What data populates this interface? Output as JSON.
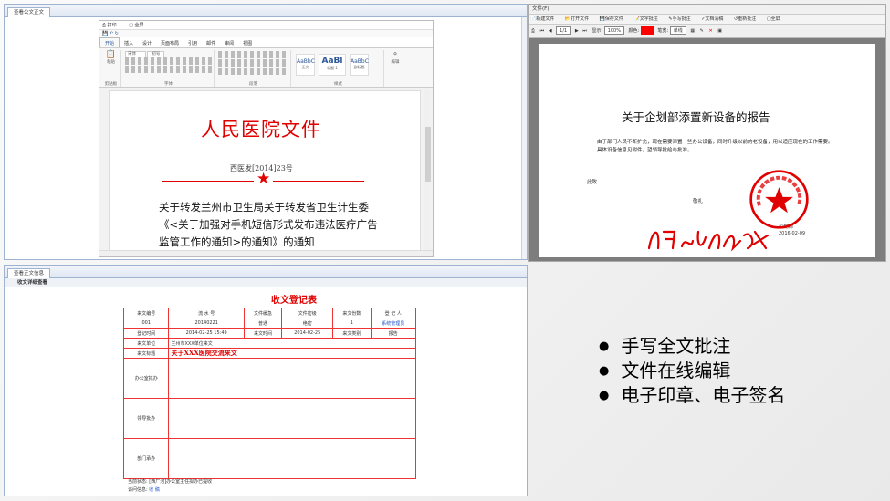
{
  "word_pane": {
    "tab": "查看公文正文",
    "toolbar": {
      "print": "打印",
      "fullscreen": "全屏"
    },
    "ribbon_tabs": [
      "开始",
      "插入",
      "设计",
      "页面布局",
      "引用",
      "邮件",
      "审阅",
      "视图"
    ],
    "ribbon_groups": {
      "clipboard": "剪贴板",
      "font": "字体",
      "paragraph": "段落",
      "styles": "样式",
      "editing": "编辑"
    },
    "paste": "粘贴",
    "font_name": "宋体",
    "font_size": "初号",
    "styles": [
      "AaBbC",
      "AaBl",
      "AaBbC"
    ],
    "style_names": [
      "正文",
      "标题 1",
      "副标题"
    ],
    "doc": {
      "red_title": "人民医院文件",
      "doc_number": "西医发[2014]23号",
      "title": "关于转发兰州市卫生局关于转发省卫生计生委《<关于加强对手机短信形式发布违法医疗广告监管工作的通知>的通知》的通知"
    }
  },
  "pdf_pane": {
    "menu": "文件(F)",
    "toolbar": [
      "新建文件",
      "打开文件",
      "保存文件",
      "文字批注",
      "手写批注",
      "文档清稿",
      "重新批注",
      "全屏"
    ],
    "nav": {
      "page": "1/1",
      "display_label": "显示:",
      "zoom": "100%",
      "color_label": "颜色:",
      "pen_label": "笔宽:",
      "pen_value": "单线",
      "accent_color": "#ff0000"
    },
    "doc": {
      "title": "关于企划部添置新设备的报告",
      "body1": "由于部门人员不断扩充，现在需要添置一些办公设备，同时升级以前的老设备，用以适应现在的工作需要。",
      "body2": "具体设备信息见附件，望领导批给与批准。",
      "greeting": "此致",
      "thanks": "敬礼",
      "dept": "企划部",
      "date": "2016-02-09",
      "seal_text": "四川省旅游信息中心",
      "signature": "同意。2017年10月13日"
    }
  },
  "form_pane": {
    "tab": "查看正文信息",
    "subtitle": "收文详细查看",
    "title": "收文登记表",
    "headers": [
      "来文编号",
      "流 水 号",
      "文件缓急",
      "文件密级",
      "来文份数",
      "登 记 人"
    ],
    "row1": [
      "001",
      "20140221",
      "普通",
      "绝密",
      "1",
      "系统管理员"
    ],
    "row2": {
      "label": "登记时间",
      "time": "2014-02-25 15:49",
      "recv_label": "来文时间",
      "recv": "2014-02-25",
      "type_label": "来文类别",
      "type": "报告"
    },
    "unit": {
      "label": "来文单位",
      "value": "兰州市XXX单位来文"
    },
    "subject": {
      "label": "来文标题",
      "value": "关于XXX医院交流来文"
    },
    "opinions": [
      "办公室拟办",
      "领导批办",
      "部门承办"
    ],
    "status": {
      "label": "当前状态:",
      "value": "[西厂河]办公室主任拟办已提收"
    },
    "access": {
      "label": "访问信息:",
      "value": "收 稿"
    }
  },
  "features": [
    "手写全文批注",
    "文件在线编辑",
    "电子印章、电子签名"
  ]
}
